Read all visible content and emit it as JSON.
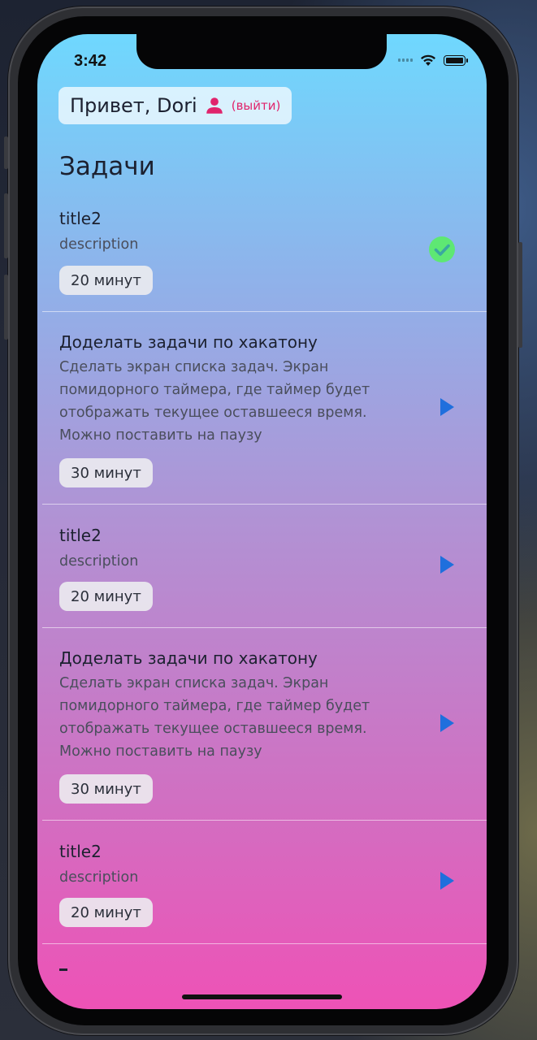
{
  "status_bar": {
    "time": "3:42"
  },
  "header": {
    "greeting": "Привет, Dori",
    "user_icon": "person-icon",
    "logout_label": "(выйти)"
  },
  "section_title": "Задачи",
  "colors": {
    "gradient_top": "#6fd8fe",
    "gradient_bottom": "#ee52b6",
    "accent_pink": "#e0246c",
    "done_green": "#5ee873",
    "play_blue": "#1f6fdd"
  },
  "tasks": [
    {
      "title": "title2",
      "description": "description",
      "duration": "20 минут",
      "status_icon": "check-circle-icon"
    },
    {
      "title": "Доделать задачи по хакатону",
      "description": "Сделать экран списка задач. Экран помидорного таймера, где таймер будет отображать текущее оставшееся время. Можно поставить на паузу",
      "duration": "30 минут",
      "status_icon": "play-icon"
    },
    {
      "title": "title2",
      "description": "description",
      "duration": "20 минут",
      "status_icon": "play-icon"
    },
    {
      "title": "Доделать задачи по хакатону",
      "description": "Сделать экран списка задач. Экран помидорного таймера, где таймер будет отображать текущее оставшееся время. Можно поставить на паузу",
      "duration": "30 минут",
      "status_icon": "play-icon"
    },
    {
      "title": "title2",
      "description": "description",
      "duration": "20 минут",
      "status_icon": "play-icon"
    }
  ]
}
